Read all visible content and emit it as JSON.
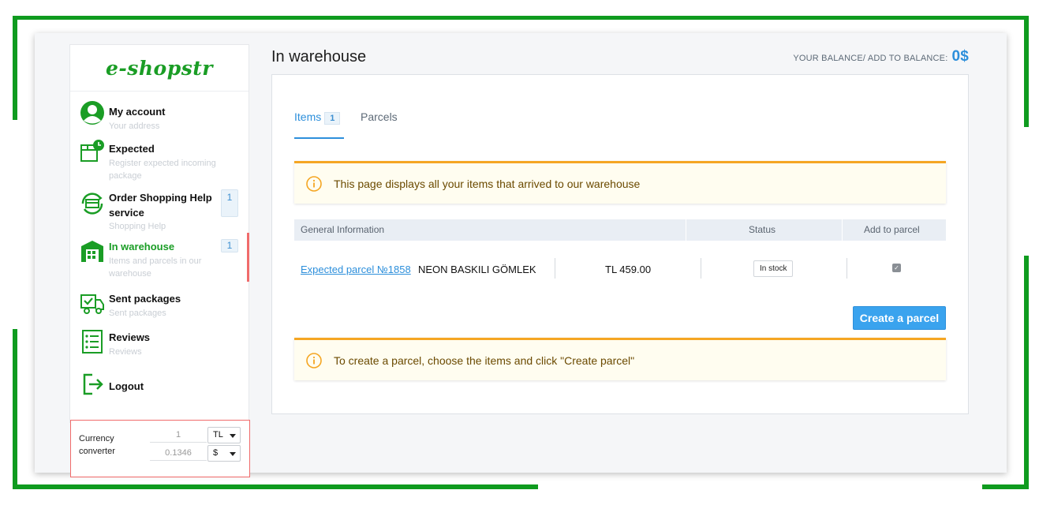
{
  "brand": {
    "logo": "e-shopstr",
    "accent": "#1a9d25",
    "frame_color": "#0f9b1f"
  },
  "sidebar": {
    "items": [
      {
        "title": "My account",
        "sub": "Your address",
        "icon": "user-circle-icon"
      },
      {
        "title": "Expected",
        "sub": "Register expected incoming package",
        "icon": "package-clock-icon"
      },
      {
        "title": "Order Shopping Help service",
        "sub": "Shopping Help",
        "icon": "shopping-help-icon",
        "badge": "1"
      },
      {
        "title": "In warehouse",
        "sub": "Items and parcels in our warehouse",
        "icon": "warehouse-icon",
        "badge": "1",
        "active": true
      },
      {
        "title": "Sent packages",
        "sub": "Sent packages",
        "icon": "truck-check-icon"
      },
      {
        "title": "Reviews",
        "sub": "Reviews",
        "icon": "reviews-list-icon"
      },
      {
        "title": "Logout",
        "sub": "",
        "icon": "logout-icon"
      }
    ],
    "currency": {
      "label": "Currency converter",
      "from_value": "1",
      "from_currency": "TL",
      "to_value": "0.1346",
      "to_currency": "$"
    }
  },
  "header": {
    "title": "In warehouse",
    "balance_label": "YOUR BALANCE/ ADD TO BALANCE:",
    "balance_amount": "0$"
  },
  "tabs": [
    {
      "label": "Items",
      "badge": "1",
      "active": true
    },
    {
      "label": "Parcels",
      "active": false
    }
  ],
  "notices": {
    "top": "This page displays all your items that arrived to our warehouse",
    "bottom": "To create a parcel, choose the items and click \"Create parcel\""
  },
  "table": {
    "headers": [
      "General Information",
      "Status",
      "Add to parcel"
    ],
    "rows": [
      {
        "link": "Expected parcel №1858",
        "name": "NEON BASKILI GÖMLEK",
        "price": "TL 459.00",
        "status": "In stock",
        "checked": true
      }
    ]
  },
  "actions": {
    "create_parcel": "Create a parcel"
  }
}
